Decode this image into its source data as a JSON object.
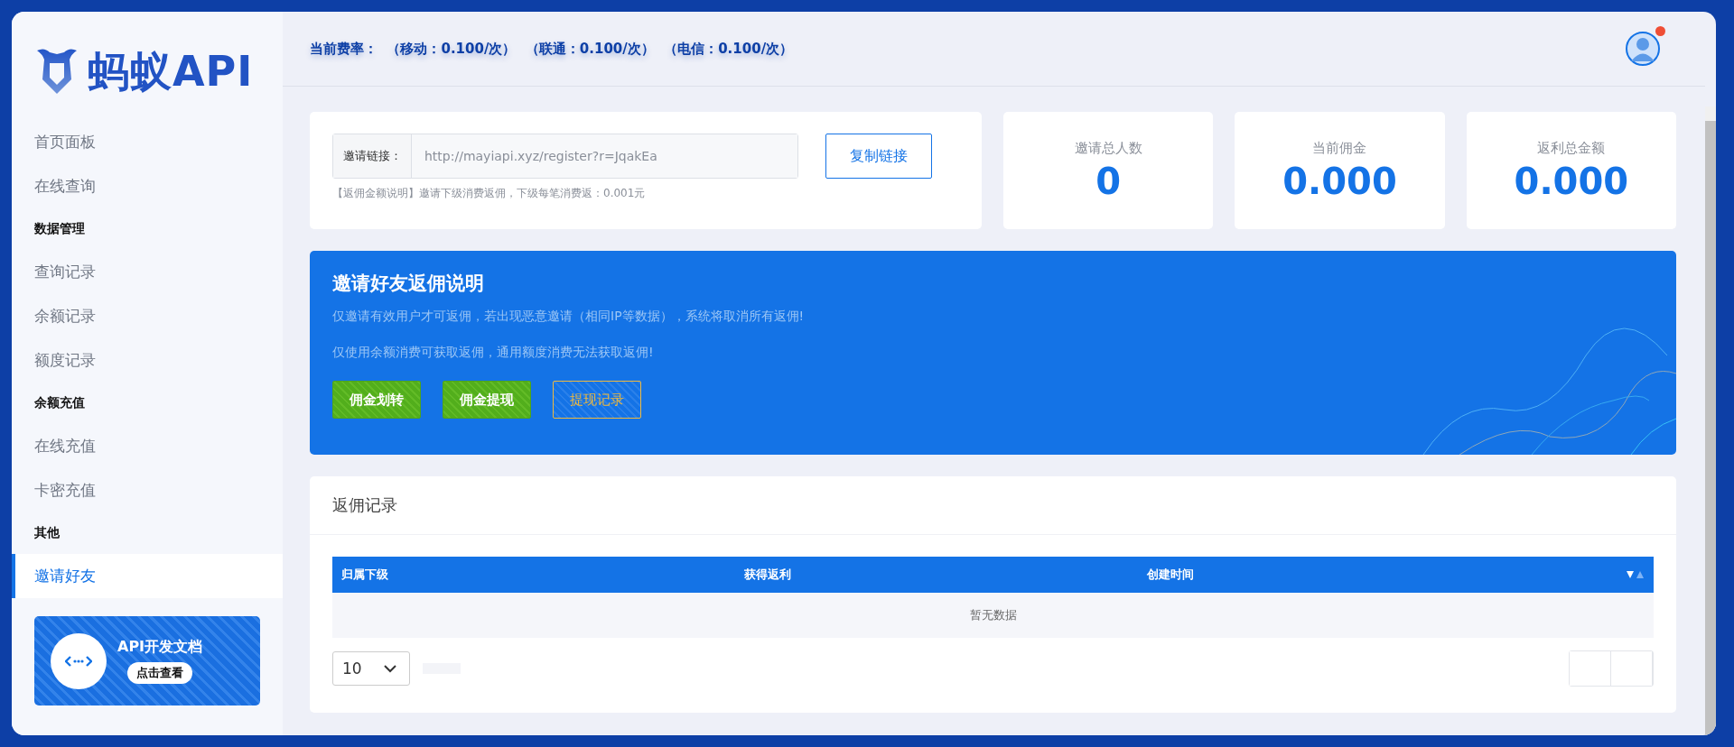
{
  "logo": {
    "text": "蚂蚁API"
  },
  "sidebar": {
    "items": [
      {
        "kind": "link",
        "label": "首页面板",
        "selected": false
      },
      {
        "kind": "link",
        "label": "在线查询",
        "selected": false
      },
      {
        "kind": "heading",
        "label": "数据管理"
      },
      {
        "kind": "link",
        "label": "查询记录",
        "selected": false
      },
      {
        "kind": "link",
        "label": "余额记录",
        "selected": false
      },
      {
        "kind": "link",
        "label": "额度记录",
        "selected": false
      },
      {
        "kind": "heading",
        "label": "余额充值"
      },
      {
        "kind": "link",
        "label": "在线充值",
        "selected": false
      },
      {
        "kind": "link",
        "label": "卡密充值",
        "selected": false
      },
      {
        "kind": "heading",
        "label": "其他"
      },
      {
        "kind": "link",
        "label": "邀请好友",
        "selected": true
      }
    ],
    "doc_card": {
      "title": "API开发文档",
      "button": "点击查看"
    }
  },
  "header": {
    "rates": "当前费率：  （移动：0.100/次）  （联通：0.100/次）  （电信：0.100/次）",
    "notification": true
  },
  "invite": {
    "label": "邀请链接：",
    "value": "http://mayiapi.xyz/register?r=JqakEa",
    "copy_button": "复制链接",
    "note": "【返佣金额说明】邀请下级消费返佣，下级每笔消费返：0.001元"
  },
  "stats": [
    {
      "label": "邀请总人数",
      "value": "0"
    },
    {
      "label": "当前佣金",
      "value": "0.000"
    },
    {
      "label": "返利总金额",
      "value": "0.000"
    }
  ],
  "banner": {
    "title": "邀请好友返佣说明",
    "lines": [
      "仅邀请有效用户才可返佣，若出现恶意邀请（相同IP等数据），系统将取消所有返佣!",
      "仅使用余额消费可获取返佣，通用额度消费无法获取返佣!"
    ],
    "buttons": [
      {
        "label": "佣金划转",
        "kind": "solid"
      },
      {
        "label": "佣金提现",
        "kind": "solid"
      },
      {
        "label": "提现记录",
        "kind": "outline"
      }
    ]
  },
  "records": {
    "title": "返佣记录",
    "columns": [
      "归属下级",
      "获得返利",
      "创建时间"
    ],
    "empty": "暂无数据",
    "page_size": "10"
  }
}
